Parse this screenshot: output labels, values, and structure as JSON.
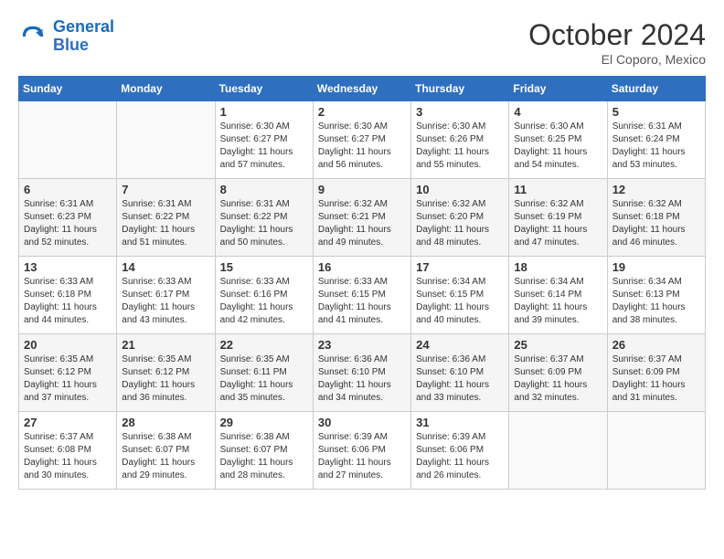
{
  "header": {
    "logo_line1": "General",
    "logo_line2": "Blue",
    "month": "October 2024",
    "location": "El Coporo, Mexico"
  },
  "days_of_week": [
    "Sunday",
    "Monday",
    "Tuesday",
    "Wednesday",
    "Thursday",
    "Friday",
    "Saturday"
  ],
  "weeks": [
    [
      {
        "day": "",
        "sunrise": "",
        "sunset": "",
        "daylight": ""
      },
      {
        "day": "",
        "sunrise": "",
        "sunset": "",
        "daylight": ""
      },
      {
        "day": "1",
        "sunrise": "Sunrise: 6:30 AM",
        "sunset": "Sunset: 6:27 PM",
        "daylight": "Daylight: 11 hours and 57 minutes."
      },
      {
        "day": "2",
        "sunrise": "Sunrise: 6:30 AM",
        "sunset": "Sunset: 6:27 PM",
        "daylight": "Daylight: 11 hours and 56 minutes."
      },
      {
        "day": "3",
        "sunrise": "Sunrise: 6:30 AM",
        "sunset": "Sunset: 6:26 PM",
        "daylight": "Daylight: 11 hours and 55 minutes."
      },
      {
        "day": "4",
        "sunrise": "Sunrise: 6:30 AM",
        "sunset": "Sunset: 6:25 PM",
        "daylight": "Daylight: 11 hours and 54 minutes."
      },
      {
        "day": "5",
        "sunrise": "Sunrise: 6:31 AM",
        "sunset": "Sunset: 6:24 PM",
        "daylight": "Daylight: 11 hours and 53 minutes."
      }
    ],
    [
      {
        "day": "6",
        "sunrise": "Sunrise: 6:31 AM",
        "sunset": "Sunset: 6:23 PM",
        "daylight": "Daylight: 11 hours and 52 minutes."
      },
      {
        "day": "7",
        "sunrise": "Sunrise: 6:31 AM",
        "sunset": "Sunset: 6:22 PM",
        "daylight": "Daylight: 11 hours and 51 minutes."
      },
      {
        "day": "8",
        "sunrise": "Sunrise: 6:31 AM",
        "sunset": "Sunset: 6:22 PM",
        "daylight": "Daylight: 11 hours and 50 minutes."
      },
      {
        "day": "9",
        "sunrise": "Sunrise: 6:32 AM",
        "sunset": "Sunset: 6:21 PM",
        "daylight": "Daylight: 11 hours and 49 minutes."
      },
      {
        "day": "10",
        "sunrise": "Sunrise: 6:32 AM",
        "sunset": "Sunset: 6:20 PM",
        "daylight": "Daylight: 11 hours and 48 minutes."
      },
      {
        "day": "11",
        "sunrise": "Sunrise: 6:32 AM",
        "sunset": "Sunset: 6:19 PM",
        "daylight": "Daylight: 11 hours and 47 minutes."
      },
      {
        "day": "12",
        "sunrise": "Sunrise: 6:32 AM",
        "sunset": "Sunset: 6:18 PM",
        "daylight": "Daylight: 11 hours and 46 minutes."
      }
    ],
    [
      {
        "day": "13",
        "sunrise": "Sunrise: 6:33 AM",
        "sunset": "Sunset: 6:18 PM",
        "daylight": "Daylight: 11 hours and 44 minutes."
      },
      {
        "day": "14",
        "sunrise": "Sunrise: 6:33 AM",
        "sunset": "Sunset: 6:17 PM",
        "daylight": "Daylight: 11 hours and 43 minutes."
      },
      {
        "day": "15",
        "sunrise": "Sunrise: 6:33 AM",
        "sunset": "Sunset: 6:16 PM",
        "daylight": "Daylight: 11 hours and 42 minutes."
      },
      {
        "day": "16",
        "sunrise": "Sunrise: 6:33 AM",
        "sunset": "Sunset: 6:15 PM",
        "daylight": "Daylight: 11 hours and 41 minutes."
      },
      {
        "day": "17",
        "sunrise": "Sunrise: 6:34 AM",
        "sunset": "Sunset: 6:15 PM",
        "daylight": "Daylight: 11 hours and 40 minutes."
      },
      {
        "day": "18",
        "sunrise": "Sunrise: 6:34 AM",
        "sunset": "Sunset: 6:14 PM",
        "daylight": "Daylight: 11 hours and 39 minutes."
      },
      {
        "day": "19",
        "sunrise": "Sunrise: 6:34 AM",
        "sunset": "Sunset: 6:13 PM",
        "daylight": "Daylight: 11 hours and 38 minutes."
      }
    ],
    [
      {
        "day": "20",
        "sunrise": "Sunrise: 6:35 AM",
        "sunset": "Sunset: 6:12 PM",
        "daylight": "Daylight: 11 hours and 37 minutes."
      },
      {
        "day": "21",
        "sunrise": "Sunrise: 6:35 AM",
        "sunset": "Sunset: 6:12 PM",
        "daylight": "Daylight: 11 hours and 36 minutes."
      },
      {
        "day": "22",
        "sunrise": "Sunrise: 6:35 AM",
        "sunset": "Sunset: 6:11 PM",
        "daylight": "Daylight: 11 hours and 35 minutes."
      },
      {
        "day": "23",
        "sunrise": "Sunrise: 6:36 AM",
        "sunset": "Sunset: 6:10 PM",
        "daylight": "Daylight: 11 hours and 34 minutes."
      },
      {
        "day": "24",
        "sunrise": "Sunrise: 6:36 AM",
        "sunset": "Sunset: 6:10 PM",
        "daylight": "Daylight: 11 hours and 33 minutes."
      },
      {
        "day": "25",
        "sunrise": "Sunrise: 6:37 AM",
        "sunset": "Sunset: 6:09 PM",
        "daylight": "Daylight: 11 hours and 32 minutes."
      },
      {
        "day": "26",
        "sunrise": "Sunrise: 6:37 AM",
        "sunset": "Sunset: 6:09 PM",
        "daylight": "Daylight: 11 hours and 31 minutes."
      }
    ],
    [
      {
        "day": "27",
        "sunrise": "Sunrise: 6:37 AM",
        "sunset": "Sunset: 6:08 PM",
        "daylight": "Daylight: 11 hours and 30 minutes."
      },
      {
        "day": "28",
        "sunrise": "Sunrise: 6:38 AM",
        "sunset": "Sunset: 6:07 PM",
        "daylight": "Daylight: 11 hours and 29 minutes."
      },
      {
        "day": "29",
        "sunrise": "Sunrise: 6:38 AM",
        "sunset": "Sunset: 6:07 PM",
        "daylight": "Daylight: 11 hours and 28 minutes."
      },
      {
        "day": "30",
        "sunrise": "Sunrise: 6:39 AM",
        "sunset": "Sunset: 6:06 PM",
        "daylight": "Daylight: 11 hours and 27 minutes."
      },
      {
        "day": "31",
        "sunrise": "Sunrise: 6:39 AM",
        "sunset": "Sunset: 6:06 PM",
        "daylight": "Daylight: 11 hours and 26 minutes."
      },
      {
        "day": "",
        "sunrise": "",
        "sunset": "",
        "daylight": ""
      },
      {
        "day": "",
        "sunrise": "",
        "sunset": "",
        "daylight": ""
      }
    ]
  ]
}
